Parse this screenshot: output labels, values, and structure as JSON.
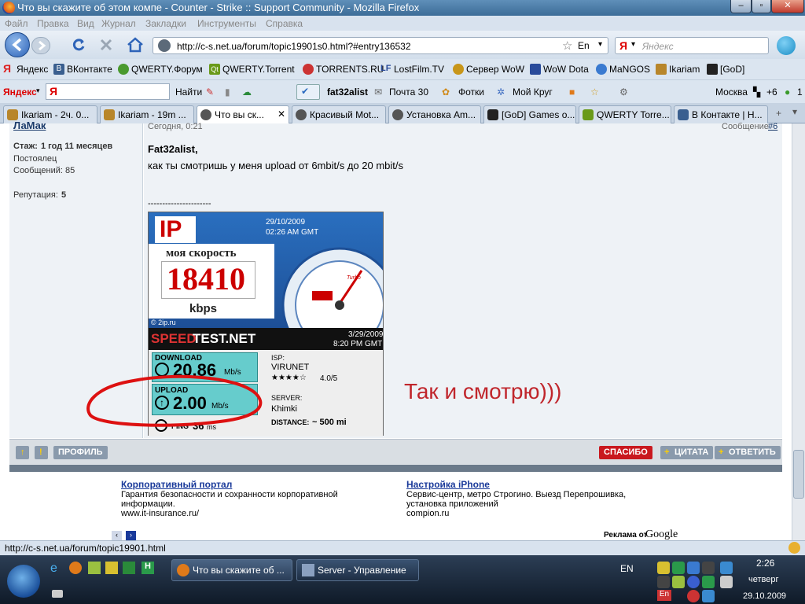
{
  "window": {
    "title": "Что вы скажите об этом компе - Counter - Strike :: Support Community - Mozilla Firefox",
    "minimize": "–",
    "maximize": "▫",
    "close": "✕"
  },
  "menu": [
    "Файл",
    "Правка",
    "Вид",
    "Журнал",
    "Закладки",
    "Инструменты",
    "Справка"
  ],
  "nav": {
    "url": "http://c-s.net.ua/forum/topic19901s0.html?#entry136532",
    "lang": "En",
    "search_placeholder": "Яндекс",
    "search_engine": "Я"
  },
  "bookmarks": [
    {
      "label": "Яндекс",
      "color": "#d22"
    },
    {
      "label": "ВКонтакте",
      "color": "#3a5f8f"
    },
    {
      "label": "QWERTY.Форум",
      "color": "#4a9a2f"
    },
    {
      "label": "QWERTY.Torrent",
      "color": "#6a9a1a"
    },
    {
      "label": "TORRENTS.RU",
      "color": "#c33"
    },
    {
      "label": "LostFilm.TV",
      "color": "#2a4b9b"
    },
    {
      "label": "Сервер WoW",
      "color": "#c8961a"
    },
    {
      "label": "WoW Dota",
      "color": "#2a4b9b"
    },
    {
      "label": "MaNGOS",
      "color": "#3a7ad0"
    },
    {
      "label": "Ikariam",
      "color": "#b8862a"
    },
    {
      "label": "[GoD]",
      "color": "#222"
    }
  ],
  "yandex_bar": {
    "brand": "Яндекс",
    "find": "Найти",
    "user": "fat32alist",
    "mail": "Почта 30",
    "photos": "Фотки",
    "circle": "Мой Круг",
    "city": "Москва",
    "temp": "+6",
    "count": "1"
  },
  "tabs": [
    {
      "label": "Ikariam - 2ч. 0...",
      "active": false
    },
    {
      "label": "Ikariam - 19m ...",
      "active": false
    },
    {
      "label": "Что вы ск...",
      "active": true
    },
    {
      "label": "Красивый Mot...",
      "active": false
    },
    {
      "label": "Установка Am...",
      "active": false
    },
    {
      "label": "[GoD] Games o...",
      "active": false
    },
    {
      "label": "QWERTY Torre...",
      "active": false
    },
    {
      "label": "В Контакте | Н...",
      "active": false
    }
  ],
  "post": {
    "author": "ЛаМак",
    "date": "Сегодня, 0:21",
    "msg_label": "Сообщение",
    "msg_num": "#6",
    "stazh_label": "Стаж:",
    "stazh": "1 год 11 месяцев",
    "rank": "Постоялец",
    "posts": "Сообщений: 85",
    "rep_label": "Репутация:",
    "rep": "5",
    "greeting": "Fat32alist,",
    "text": "как ты смотришь у меня upload от 6mbit/s до 20 mbit/s",
    "sig_line": "----------------------",
    "annotation": "Так и смотрю)))"
  },
  "speedtest": {
    "ip_date": "29/10/2009",
    "ip_time": "02:26 AM GMT",
    "ip_logo": "IP",
    "my_speed": "моя скорость",
    "speed": "18410",
    "unit": "kbps",
    "site": "© 2ip.ru",
    "gauge_brand": "Turbo",
    "st_logo_a": "SPEED",
    "st_logo_b": "TEST.NET",
    "st_date": "3/29/2009",
    "st_time": "8:20 PM GMT",
    "download_label": "DOWNLOAD",
    "download": "20.86",
    "upload_label": "UPLOAD",
    "upload": "2.00",
    "mbs": "Mb/s",
    "ping_label": "PING",
    "ping": "36",
    "ms": "ms",
    "isp_label": "ISP:",
    "isp": "VIRUNET",
    "rating": "4.0/5",
    "stars": "★★★★☆",
    "server_label": "SERVER:",
    "server": "Khimki",
    "distance_label": "DISTANCE:",
    "distance": "~ 500 mi"
  },
  "actions": {
    "profile": "ПРОФИЛЬ",
    "thanks": "СПАСИБО",
    "quote": "ЦИТАТА",
    "reply": "ОТВЕТИТЬ"
  },
  "ads": [
    {
      "title": "Корпоративный портал",
      "text": "Гарантия безопасности и сохранности корпоративной информации.",
      "url": "www.it-insurance.ru/"
    },
    {
      "title": "Настройка iPhone",
      "text": "Сервис-центр, метро Строгино. Выезд Перепрошивка, установка приложений",
      "url": "compion.ru"
    }
  ],
  "ads_by": "Реклама от",
  "google": "Google",
  "status_url": "http://c-s.net.ua/forum/topic19901.html",
  "taskbar": {
    "tasks": [
      "Что вы скажите об ...",
      "Server - Управление"
    ],
    "lang": "EN",
    "lang2": "En",
    "time": "2:26",
    "day": "четверг",
    "date": "29.10.2009"
  }
}
